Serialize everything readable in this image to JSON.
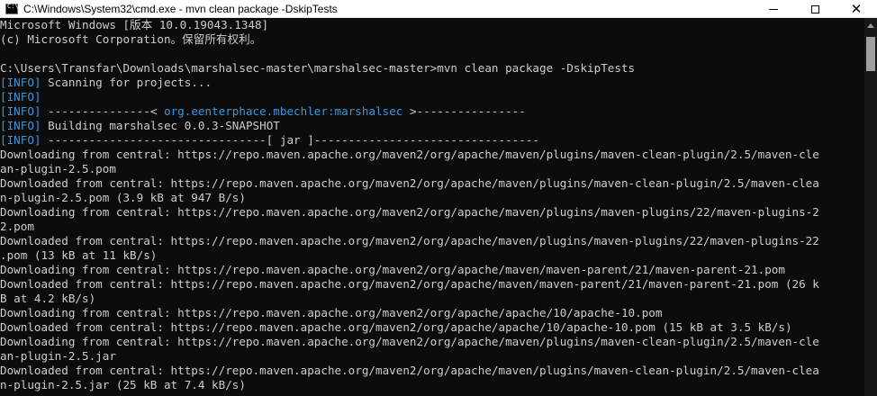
{
  "window": {
    "title": "C:\\Windows\\System32\\cmd.exe - mvn  clean package -DskipTests",
    "icon": "cmd-icon",
    "controls": {
      "minimize": "minimize-icon",
      "maximize": "maximize-icon",
      "close": "close-icon"
    },
    "close_glyph": "✕"
  },
  "console": {
    "lines": [
      {
        "text": "Microsoft Windows [版本 10.0.19043.1348]"
      },
      {
        "text": "(c) Microsoft Corporation。保留所有权利。"
      },
      {
        "text": ""
      },
      {
        "text": "C:\\Users\\Transfar\\Downloads\\marshalsec-master\\marshalsec-master>mvn clean package -DskipTests"
      },
      {
        "tag": "[INFO]",
        "text": " Scanning for projects..."
      },
      {
        "tag": "[INFO]",
        "text": ""
      },
      {
        "tag": "[INFO]",
        "pre": " ---------------< ",
        "link": "org.eenterphace.mbechler:marshalsec",
        "post": " >----------------"
      },
      {
        "tag": "[INFO]",
        "text": " Building marshalsec 0.0.3-SNAPSHOT"
      },
      {
        "tag": "[INFO]",
        "text": " --------------------------------[ jar ]---------------------------------"
      },
      {
        "text": "Downloading from central: https://repo.maven.apache.org/maven2/org/apache/maven/plugins/maven-clean-plugin/2.5/maven-cle"
      },
      {
        "text": "an-plugin-2.5.pom"
      },
      {
        "text": "Downloaded from central: https://repo.maven.apache.org/maven2/org/apache/maven/plugins/maven-clean-plugin/2.5/maven-clea"
      },
      {
        "text": "n-plugin-2.5.pom (3.9 kB at 947 B/s)"
      },
      {
        "text": "Downloading from central: https://repo.maven.apache.org/maven2/org/apache/maven/plugins/maven-plugins/22/maven-plugins-2"
      },
      {
        "text": "2.pom"
      },
      {
        "text": "Downloaded from central: https://repo.maven.apache.org/maven2/org/apache/maven/plugins/maven-plugins/22/maven-plugins-22"
      },
      {
        "text": ".pom (13 kB at 11 kB/s)"
      },
      {
        "text": "Downloading from central: https://repo.maven.apache.org/maven2/org/apache/maven/maven-parent/21/maven-parent-21.pom"
      },
      {
        "text": "Downloaded from central: https://repo.maven.apache.org/maven2/org/apache/maven/maven-parent/21/maven-parent-21.pom (26 k"
      },
      {
        "text": "B at 4.2 kB/s)"
      },
      {
        "text": "Downloading from central: https://repo.maven.apache.org/maven2/org/apache/apache/10/apache-10.pom"
      },
      {
        "text": "Downloaded from central: https://repo.maven.apache.org/maven2/org/apache/apache/10/apache-10.pom (15 kB at 3.5 kB/s)"
      },
      {
        "text": "Downloading from central: https://repo.maven.apache.org/maven2/org/apache/maven/plugins/maven-clean-plugin/2.5/maven-cle"
      },
      {
        "text": "an-plugin-2.5.jar"
      },
      {
        "text": "Downloaded from central: https://repo.maven.apache.org/maven2/org/apache/maven/plugins/maven-clean-plugin/2.5/maven-clea"
      },
      {
        "text": "n-plugin-2.5.jar (25 kB at 7.4 kB/s)"
      }
    ]
  },
  "colors": {
    "background": "#0c0c0c",
    "text": "#cccccc",
    "info": "#3a96dd",
    "titlebar": "#ffffff"
  }
}
